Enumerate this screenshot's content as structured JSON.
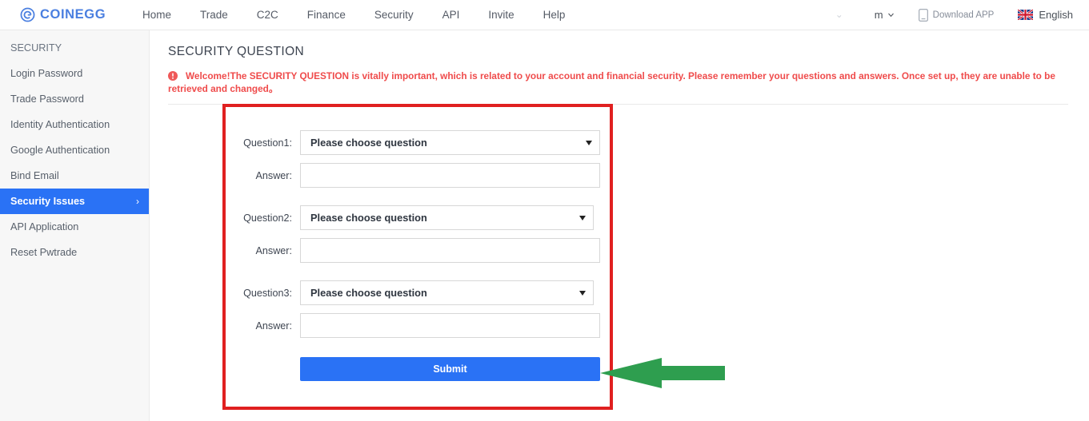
{
  "header": {
    "logo_text": "COINEGG",
    "logo_icon": "coinegg-circle-g-logo",
    "nav": [
      {
        "label": "Home"
      },
      {
        "label": "Trade"
      },
      {
        "label": "C2C"
      },
      {
        "label": "Finance"
      },
      {
        "label": "Security"
      },
      {
        "label": "API"
      },
      {
        "label": "Invite"
      },
      {
        "label": "Help"
      }
    ],
    "ghost_item": "⌄",
    "currency": {
      "label": "m",
      "icon": "chevron-down-icon"
    },
    "download": {
      "label": "Download APP",
      "icon": "mobile-phone-icon"
    },
    "language": {
      "label": "English",
      "icon": "uk-flag-icon"
    }
  },
  "sidebar": {
    "items": [
      {
        "label": "SECURITY",
        "type": "header"
      },
      {
        "label": "Login Password",
        "type": "link"
      },
      {
        "label": "Trade Password",
        "type": "link"
      },
      {
        "label": "Identity Authentication",
        "type": "link"
      },
      {
        "label": "Google Authentication",
        "type": "link"
      },
      {
        "label": "Bind Email",
        "type": "link"
      },
      {
        "label": "Security Issues",
        "type": "link",
        "active": true,
        "arrow": "›"
      },
      {
        "label": "API Application",
        "type": "link"
      },
      {
        "label": "Reset Pwtrade",
        "type": "link"
      }
    ]
  },
  "main": {
    "page_title": "SECURITY QUESTION",
    "notice_icon": "error-exclamation-icon",
    "notice_text": "Welcome!The SECURITY QUESTION is vitally important, which is related to your account and financial security. Please remember your questions and answers. Once set up, they are unable to be retrieved and changed。",
    "form": {
      "question1_label": "Question1:",
      "question1_value": "Please choose question",
      "answer1_label": "Answer:",
      "answer1_value": "",
      "question2_label": "Question2:",
      "question2_value": "Please choose question",
      "answer2_label": "Answer:",
      "answer2_value": "",
      "question3_label": "Question3:",
      "question3_value": "Please choose question",
      "answer3_label": "Answer:",
      "answer3_value": "",
      "submit_label": "Submit",
      "dropdown_arrow_icon": "caret-down-icon"
    },
    "annotations": {
      "highlight_box": {
        "color": "#e02020",
        "shape": "rectangle-outline"
      },
      "pointer_arrow": {
        "color": "#2e9e4f",
        "icon": "left-pointing-arrow"
      }
    }
  },
  "colors": {
    "brand_blue": "#2a72f5",
    "logo_blue": "#4a7fe0",
    "notice_red": "#ef4b4b",
    "highlight_red": "#e02020",
    "annotation_green": "#2e9e4f",
    "sidebar_bg": "#f7f7f7"
  }
}
